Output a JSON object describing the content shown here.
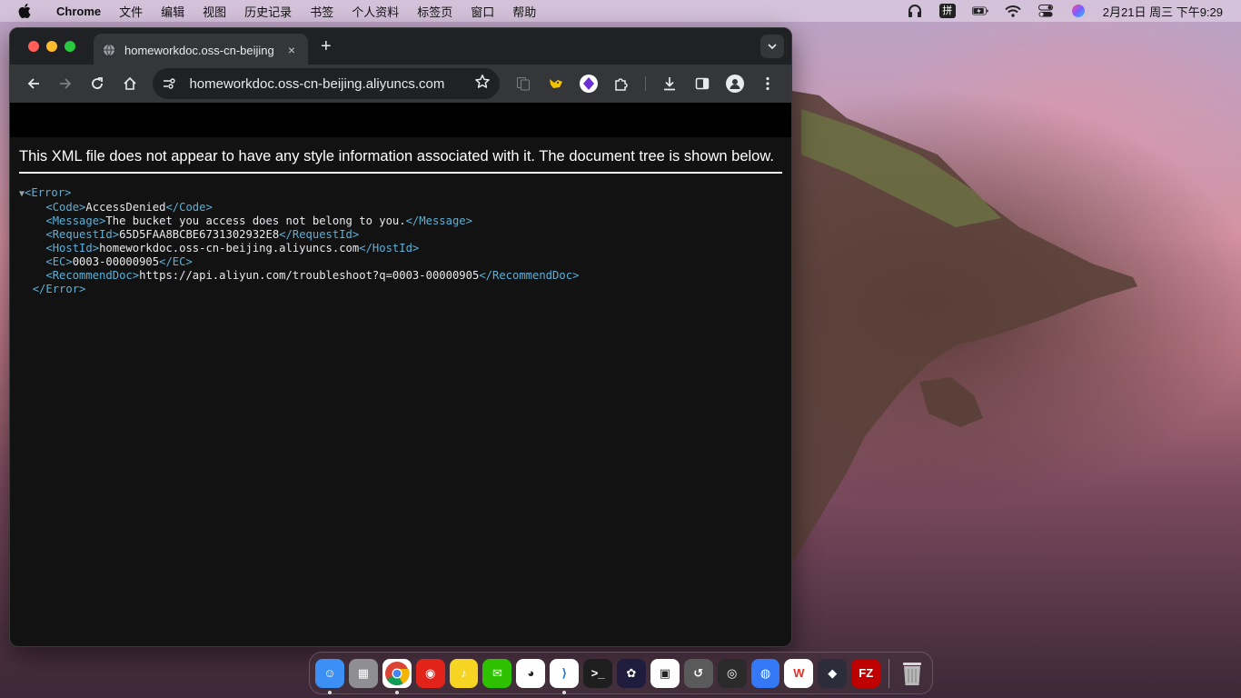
{
  "menubar": {
    "app_name": "Chrome",
    "items": [
      "文件",
      "编辑",
      "视图",
      "历史记录",
      "书签",
      "个人资料",
      "标签页",
      "窗口",
      "帮助"
    ],
    "input_method": "拼",
    "clock": "2月21日 周三 下午9:29"
  },
  "browser": {
    "tab_title": "homeworkdoc.oss-cn-beijing",
    "tab_close": "×",
    "new_tab": "+",
    "url": "homeworkdoc.oss-cn-beijing.aliyuncs.com"
  },
  "page": {
    "header_message": "This XML file does not appear to have any style information associated with it. The document tree is shown below.",
    "toggle": "▼",
    "xml": {
      "root_open": "<Error>",
      "root_close": "</Error>",
      "elements": [
        {
          "open": "<Code>",
          "text": "AccessDenied",
          "close": "</Code>"
        },
        {
          "open": "<Message>",
          "text": "The bucket you access does not belong to you.",
          "close": "</Message>"
        },
        {
          "open": "<RequestId>",
          "text": "65D5FAA8BCBE6731302932E8",
          "close": "</RequestId>"
        },
        {
          "open": "<HostId>",
          "text": "homeworkdoc.oss-cn-beijing.aliyuncs.com",
          "close": "</HostId>"
        },
        {
          "open": "<EC>",
          "text": "0003-00000905",
          "close": "</EC>"
        },
        {
          "open": "<RecommendDoc>",
          "text": "https://api.aliyun.com/troubleshoot?q=0003-00000905",
          "close": "</RecommendDoc>"
        }
      ]
    }
  },
  "dock": {
    "items": [
      {
        "name": "finder",
        "color": "#3b8ff5",
        "glyph": "☺",
        "running": true
      },
      {
        "name": "launchpad",
        "color": "#8e8e93",
        "glyph": "▦",
        "running": false
      },
      {
        "name": "chrome",
        "color": "#ffffff",
        "glyph": "",
        "running": true
      },
      {
        "name": "netease-music",
        "color": "#e2231a",
        "glyph": "◉",
        "running": false
      },
      {
        "name": "qq-music",
        "color": "#f5d423",
        "glyph": "♪",
        "running": false
      },
      {
        "name": "wechat",
        "color": "#2dc100",
        "glyph": "✉",
        "running": false
      },
      {
        "name": "qq",
        "color": "#ffffff",
        "glyph": "◕",
        "running": false
      },
      {
        "name": "vscode",
        "color": "#ffffff",
        "glyph": "⟩",
        "running": true
      },
      {
        "name": "terminal",
        "color": "#1e1e1e",
        "glyph": ">_",
        "running": false
      },
      {
        "name": "chatgpt",
        "color": "#1f1c3d",
        "glyph": "✿",
        "running": false
      },
      {
        "name": "parallels",
        "color": "#ffffff",
        "glyph": "▣",
        "running": false
      },
      {
        "name": "time-machine",
        "color": "#5a5a5a",
        "glyph": "↺",
        "running": false
      },
      {
        "name": "screenshot",
        "color": "#2a2a2a",
        "glyph": "◎",
        "running": false
      },
      {
        "name": "qq-alt",
        "color": "#3478f6",
        "glyph": "◍",
        "running": false
      },
      {
        "name": "wps",
        "color": "#ffffff",
        "glyph": "W",
        "running": false
      },
      {
        "name": "davinci",
        "color": "#2c2c3a",
        "glyph": "◆",
        "running": false
      },
      {
        "name": "filezilla",
        "color": "#bf0000",
        "glyph": "FZ",
        "running": false
      }
    ],
    "trash": {
      "name": "trash",
      "glyph": "🗑"
    }
  }
}
